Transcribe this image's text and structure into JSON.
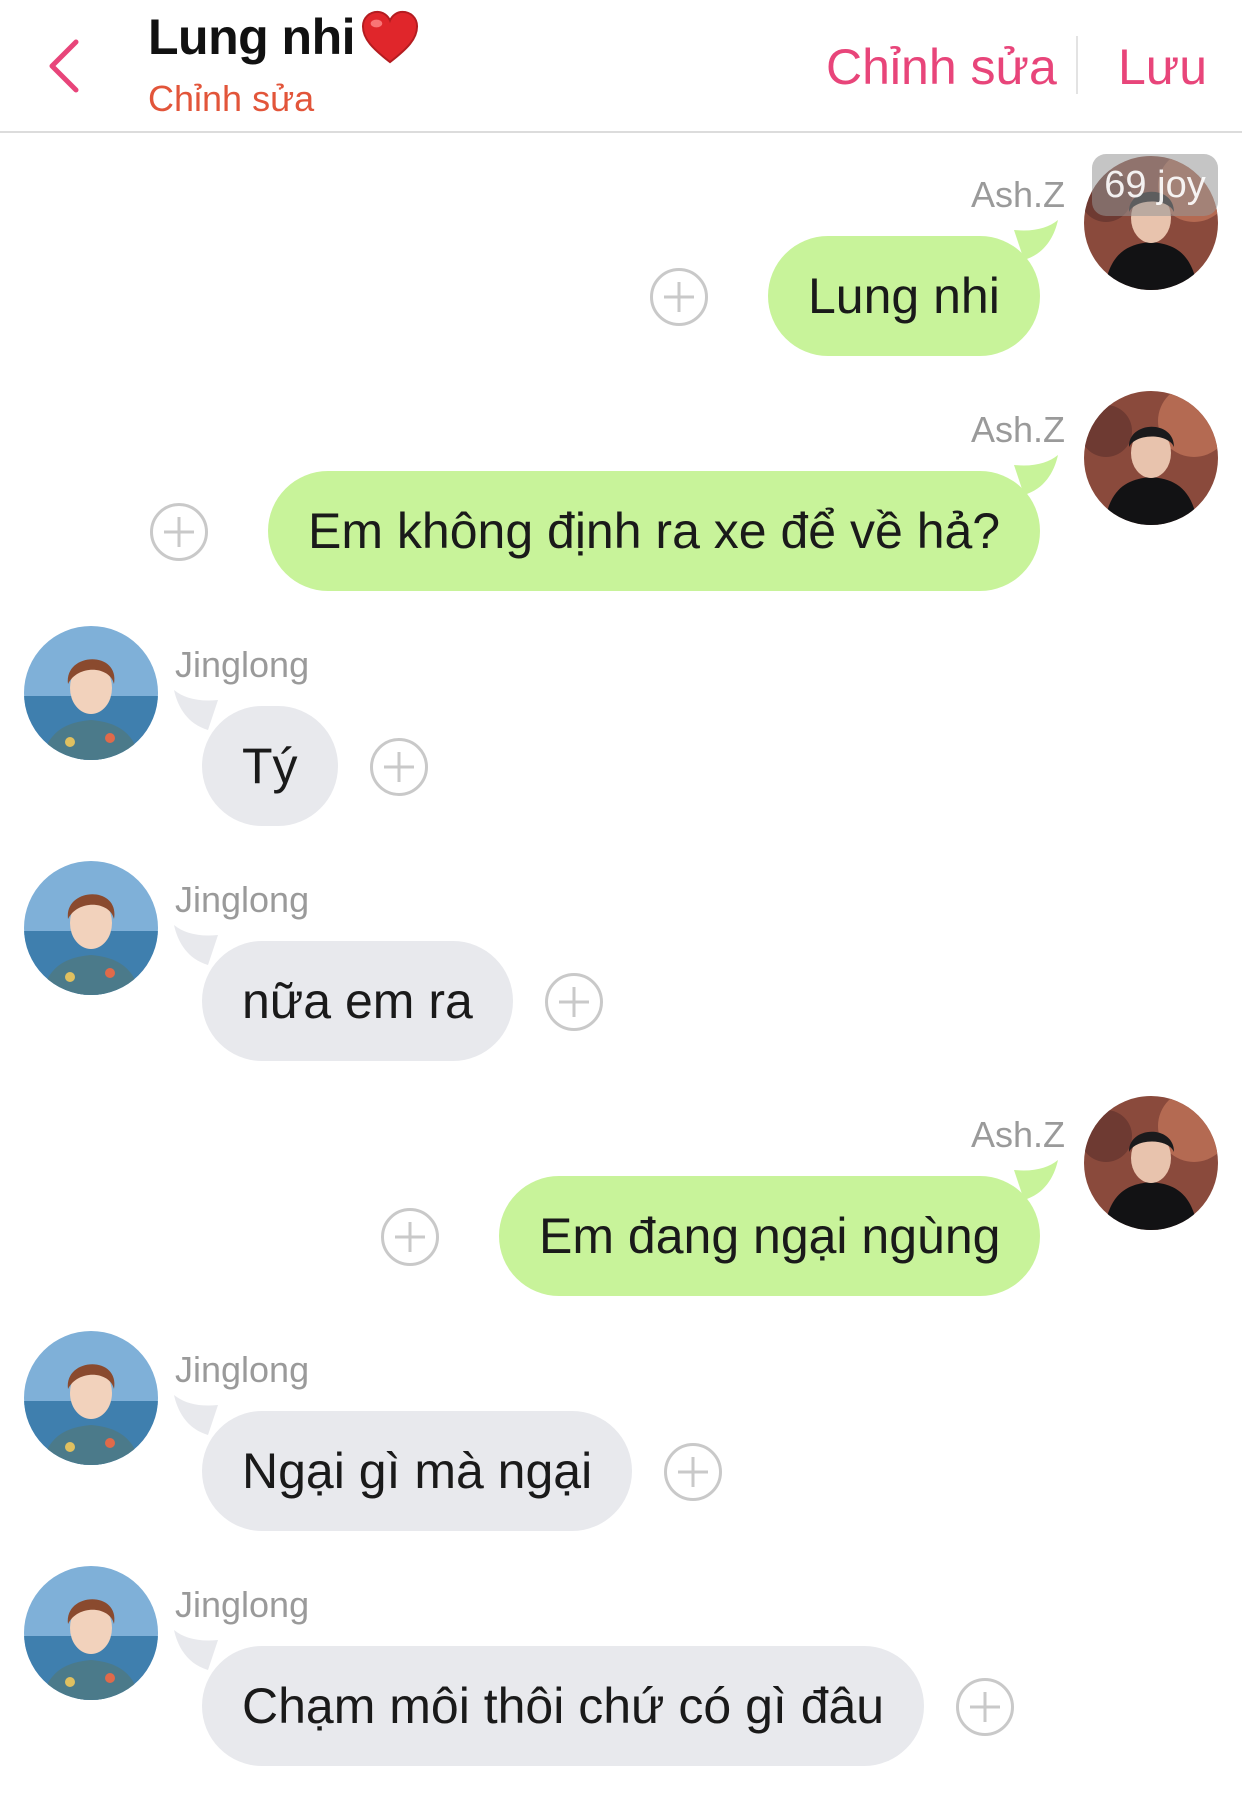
{
  "header": {
    "title": "Lung nhi",
    "subtitle": "Chỉnh sửa",
    "edit_label": "Chỉnh sửa",
    "save_label": "Lưu"
  },
  "watermark": "69 joy",
  "messages": [
    {
      "sender": "Ash.Z",
      "direction": "out",
      "text": "Lung nhi"
    },
    {
      "sender": "Ash.Z",
      "direction": "out",
      "text": "Em không định ra xe để về hả?"
    },
    {
      "sender": "Jinglong",
      "direction": "in",
      "text": "Tý"
    },
    {
      "sender": "Jinglong",
      "direction": "in",
      "text": "nữa em ra"
    },
    {
      "sender": "Ash.Z",
      "direction": "out",
      "text": "Em đang ngại ngùng"
    },
    {
      "sender": "Jinglong",
      "direction": "in",
      "text": "Ngại gì mà ngại"
    },
    {
      "sender": "Jinglong",
      "direction": "in",
      "text": "Chạm môi thôi chứ có gì đâu"
    }
  ],
  "colors": {
    "accent": "#e8457a",
    "subtitle": "#e2553a",
    "outgoing_bubble": "#c8f39a",
    "incoming_bubble": "#e8e9ed"
  }
}
